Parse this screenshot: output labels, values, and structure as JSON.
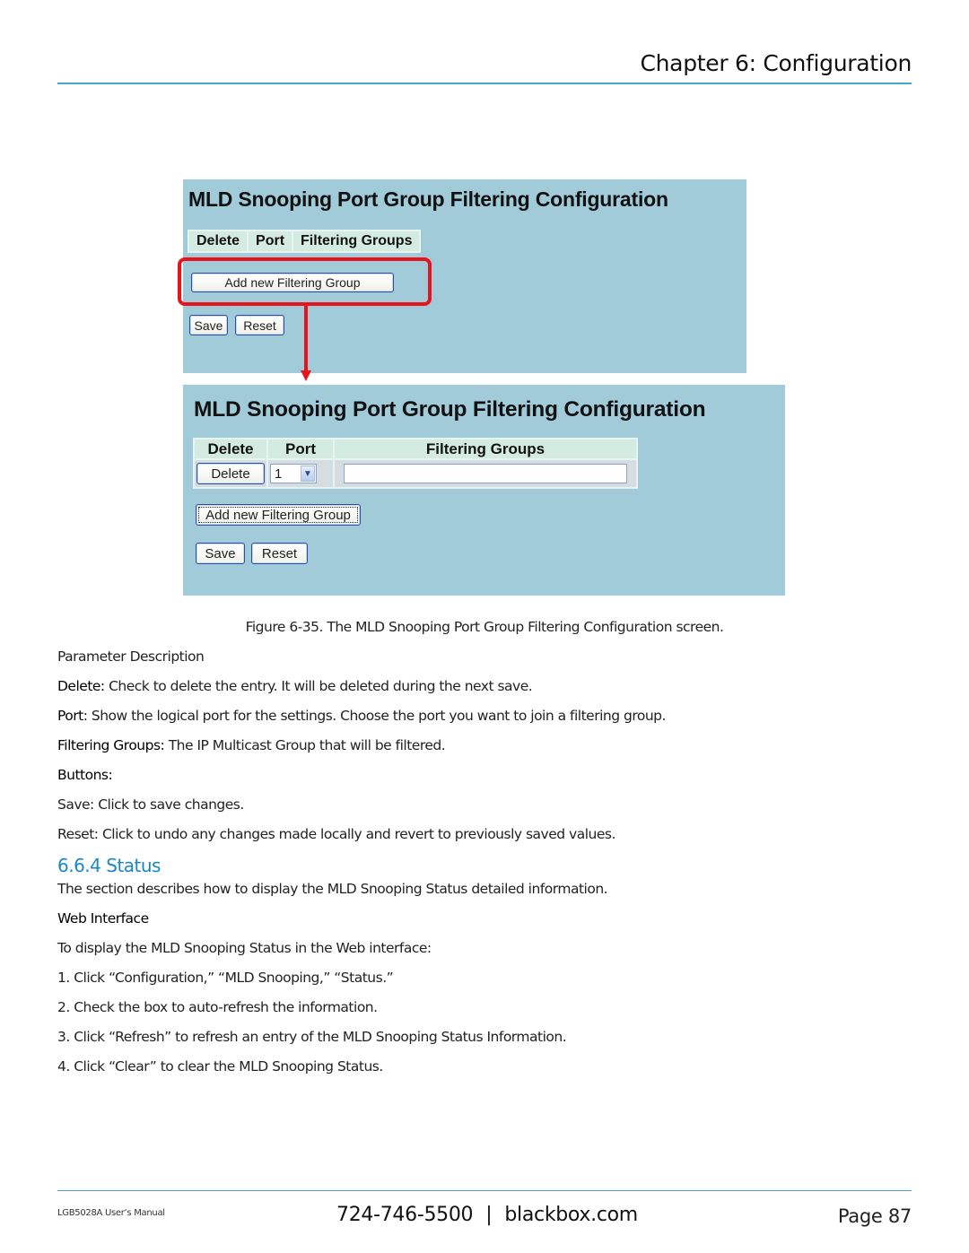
{
  "header": {
    "chapter_title": "Chapter 6: Configuration"
  },
  "figure": {
    "before_screen": {
      "title": "MLD Snooping Port Group Filtering Configuration",
      "columns": [
        "Delete",
        "Port",
        "Filtering Groups"
      ],
      "add_button": "Add new Filtering Group",
      "save_button": "Save",
      "reset_button": "Reset"
    },
    "after_screen": {
      "title": "MLD Snooping Port Group Filtering Configuration",
      "columns": [
        "Delete",
        "Port",
        "Filtering Groups"
      ],
      "rows": [
        {
          "delete_button": "Delete",
          "port": "1",
          "filtering_groups_value": ""
        }
      ],
      "add_button": "Add new Filtering Group",
      "save_button": "Save",
      "reset_button": "Reset"
    },
    "callout_color": "#e8141c",
    "caption": "Figure 6-35. The MLD Snooping Port Group Filtering Configuration screen."
  },
  "body": {
    "param_heading": "Parameter Description",
    "params": [
      {
        "term": "Delete:",
        "desc": " Check to delete the entry. It will be deleted during the next save."
      },
      {
        "term": "Port:",
        "desc": " Show the logical port for the settings. Choose the port you want to join a filtering group."
      },
      {
        "term": "Filtering Groups:",
        "desc": " The IP Multicast Group that will be filtered."
      }
    ],
    "buttons_heading": "Buttons:",
    "buttons": [
      "Save: Click to save changes.",
      "Reset: Click to undo any changes made locally and revert to previously saved values."
    ],
    "section_heading": "6.6.4 Status",
    "section_intro": "The section describes how to display the MLD Snooping Status detailed information.",
    "web_interface_heading": "Web Interface",
    "web_interface_intro": "To display the MLD Snooping Status in the Web interface:",
    "steps": [
      "1. Click “Configuration,” “MLD Snooping,” “Status.”",
      "2. Check the box to auto-refresh the information.",
      "3. Click “Refresh” to refresh an entry of the MLD Snooping Status Information.",
      "4. Click “Clear” to clear the MLD Snooping Status."
    ]
  },
  "footer": {
    "manual_name": "LGB5028A User’s Manual",
    "phone": "724-746-5500",
    "separator": "|",
    "website": "blackbox.com",
    "page_label": "Page 87"
  }
}
